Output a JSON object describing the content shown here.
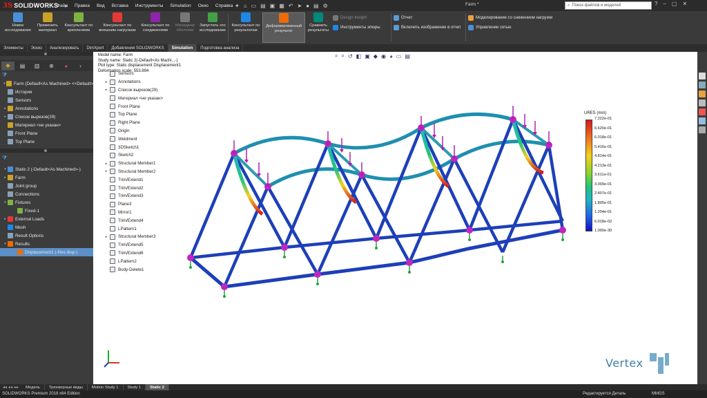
{
  "titlebar": {
    "logo_ds": "3S",
    "logo_text": "SOLIDWORKS",
    "menu": [
      "Файл",
      "Правка",
      "Вид",
      "Вставка",
      "Инструменты",
      "Simulation",
      "Окно",
      "Справка"
    ],
    "document_title": "Farm *",
    "search_placeholder": "Поиск файлов и моделей"
  },
  "ribbon": {
    "buttons": [
      {
        "label": "Новое исследование",
        "color": "#4a90d9"
      },
      {
        "label": "Применить материал",
        "color": "#c9a227"
      },
      {
        "label": "Консультант по креплениям",
        "color": "#7cb342"
      },
      {
        "label": "Консультант по внешним нагрузкам",
        "color": "#e53935"
      },
      {
        "label": "Консультант по соединениям",
        "color": "#8e24aa"
      },
      {
        "label": "Менеджер оболочки",
        "color": "#777777",
        "dim": true
      },
      {
        "label": "Запустить это исследование",
        "color": "#43a047"
      },
      {
        "label": "Консультант по результатам",
        "color": "#1e88e5"
      },
      {
        "label": "Деформированный результат",
        "color": "#ef6c00",
        "active": true
      },
      {
        "label": "Сравнить результаты",
        "color": "#00897b"
      }
    ],
    "small": [
      {
        "label": "Design Insight",
        "dim": true
      },
      {
        "label": "Инструменты эпюры"
      },
      {
        "label": "Отчет"
      },
      {
        "label": "Включить изображение в отчет"
      },
      {
        "label": "Моделирование со снижением нагрузки"
      },
      {
        "label": "Управление сетью"
      }
    ]
  },
  "cm_tabs": [
    "Элементы",
    "Эскиз",
    "Анализировать",
    "DimXpert",
    "Добавления SOLIDWORKS",
    "Simulation",
    "Подготовка анализа"
  ],
  "cm_active_tab": "Simulation",
  "feature_tree": [
    {
      "label": "Farm  (Default<As Machined> <<Default>",
      "color": "#c9a227",
      "exp": "▾"
    },
    {
      "label": "История",
      "color": "#8aa0b8"
    },
    {
      "label": "Sensors",
      "color": "#8aa0b8"
    },
    {
      "label": "Annotations",
      "color": "#c9a227",
      "exp": "▸"
    },
    {
      "label": "Список вырезов(29)",
      "color": "#8aa0b8",
      "exp": "▸"
    },
    {
      "label": "Материал <не указан>",
      "color": "#c9a227"
    },
    {
      "label": "Front Plane",
      "color": "#8aa0b8"
    },
    {
      "label": "Top Plane",
      "color": "#8aa0b8"
    }
  ],
  "sim_tree": [
    {
      "label": "Static 2 (-Default<As Machined>-)",
      "color": "#4a90d9",
      "exp": "▾"
    },
    {
      "label": "Farm",
      "color": "#c9a227",
      "exp": "▸"
    },
    {
      "label": "Joint group",
      "color": "#8aa0b8"
    },
    {
      "label": "Connections",
      "color": "#8aa0b8"
    },
    {
      "label": "Fixtures",
      "color": "#7cb342",
      "exp": "▾"
    },
    {
      "label": "Fixed-1",
      "color": "#7cb342",
      "indent": true
    },
    {
      "label": "External Loads",
      "color": "#e53935",
      "exp": "▸"
    },
    {
      "label": "Mesh",
      "color": "#1e88e5"
    },
    {
      "label": "Result Options",
      "color": "#8aa0b8"
    },
    {
      "label": "Results",
      "color": "#ef6c00",
      "exp": "▾"
    },
    {
      "label": "Displacement1 (-Res disp-)",
      "color": "#ef6c00",
      "indent": true,
      "selected": true
    }
  ],
  "viewport": {
    "study_info": [
      "Model name: Farm",
      "Study name: Static 2(-Default<As Machi...-)",
      "Plot type: Static displacement Displacement1",
      "Deformation scale: 553.894"
    ],
    "overlay_tree": [
      {
        "label": "Sensors",
        "exp": ""
      },
      {
        "label": "Annotations",
        "exp": "▸"
      },
      {
        "label": "Список вырезов(29)",
        "exp": "▸"
      },
      {
        "label": "Материал <не указан>",
        "exp": ""
      },
      {
        "label": "Front Plane",
        "exp": ""
      },
      {
        "label": "Top Plane",
        "exp": ""
      },
      {
        "label": "Right Plane",
        "exp": ""
      },
      {
        "label": "Origin",
        "exp": ""
      },
      {
        "label": "Weldment",
        "exp": ""
      },
      {
        "label": "3DSketch1",
        "exp": ""
      },
      {
        "label": "Sketch2",
        "exp": ""
      },
      {
        "label": "Structural Member1",
        "exp": "▸"
      },
      {
        "label": "Structural Member2",
        "exp": "▸"
      },
      {
        "label": "Trim/Extend1",
        "exp": ""
      },
      {
        "label": "Trim/Extend2",
        "exp": ""
      },
      {
        "label": "Trim/Extend3",
        "exp": ""
      },
      {
        "label": "Plane3",
        "exp": ""
      },
      {
        "label": "Mirror1",
        "exp": ""
      },
      {
        "label": "Trim/Extend4",
        "exp": ""
      },
      {
        "label": "LPattern1",
        "exp": ""
      },
      {
        "label": "Structural Member3",
        "exp": "▸"
      },
      {
        "label": "Trim/Extend5",
        "exp": ""
      },
      {
        "label": "Trim/Extend6",
        "exp": ""
      },
      {
        "label": "LPattern2",
        "exp": ""
      },
      {
        "label": "Body-Delete1",
        "exp": ""
      }
    ],
    "legend_title": "URES (mm)",
    "legend_ticks": [
      "7.222e-01",
      "6.620e-01",
      "6.018e-01",
      "5.416e-01",
      "4.814e-01",
      "4.213e-01",
      "3.611e-01",
      "3.009e-01",
      "2.407e-01",
      "1.805e-01",
      "1.204e-01",
      "6.018e-02",
      "1.000e-30"
    ],
    "watermark": "Vertex"
  },
  "bottom_tabs": [
    "Модель",
    "Трехмерные виды",
    "Motion Study 1",
    "Study 1",
    "Static 2"
  ],
  "bottom_active": "Static 2",
  "status": {
    "left": "SOLIDWORKS Premium 2018 x64 Edition",
    "mode": "Редактируется Деталь",
    "units": "MMGS"
  }
}
